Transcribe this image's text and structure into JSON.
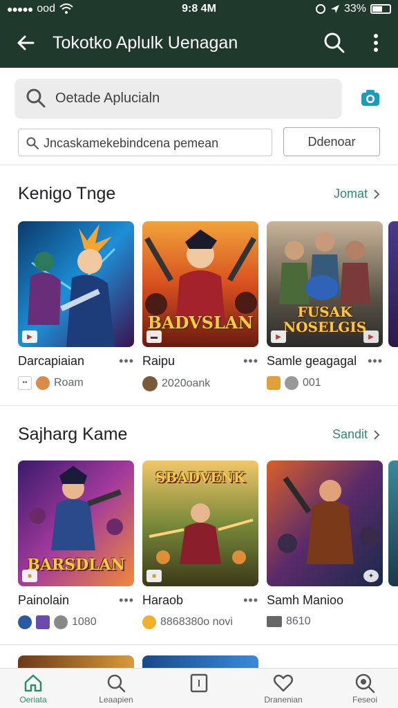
{
  "status_bar": {
    "time": "9:8 4M",
    "carrier": "ood",
    "battery": "33%"
  },
  "app_bar": {
    "title": "Tokotko Aplulk Uenagan"
  },
  "search": {
    "placeholder": "Oetade Aplucialn"
  },
  "filter": {
    "text": "Jncaskamekebindcena pemean",
    "button_label": "Ddenoar"
  },
  "sections": [
    {
      "title": "Kenigo Tnge",
      "link": "Jomat",
      "cards": [
        {
          "name": "Darcapiaian",
          "meta": "Roam",
          "art_text": ""
        },
        {
          "name": "Raipu",
          "meta": "2020oank",
          "art_text": "BADVSLAN"
        },
        {
          "name": "Samle geagagal",
          "meta": "001",
          "art_text": "FUSAK NOSELGIS"
        }
      ]
    },
    {
      "title": "Sajharg Kame",
      "link": "Sandit",
      "cards": [
        {
          "name": "Painolain",
          "meta": "1080",
          "art_text": "BARSDLAN"
        },
        {
          "name": "Haraob",
          "meta": "8868380o novi",
          "art_text": "SBADVENK"
        },
        {
          "name": "Samh Manioo",
          "meta": "8610",
          "art_text": ""
        }
      ]
    }
  ],
  "bottom_nav": [
    {
      "label": "Oeriata",
      "icon": "home-icon",
      "active": true
    },
    {
      "label": "Leaapien",
      "icon": "search-icon",
      "active": false
    },
    {
      "label": "",
      "icon": "book-icon",
      "active": false
    },
    {
      "label": "Dranenian",
      "icon": "heart-icon",
      "active": false
    },
    {
      "label": "Feseoi",
      "icon": "search-zoom-icon",
      "active": false
    }
  ],
  "colors": {
    "app_bar": "#1f3a2a",
    "accent": "#2e8b6e"
  }
}
